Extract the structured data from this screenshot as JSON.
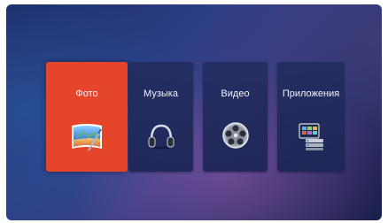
{
  "menu": {
    "tiles": [
      {
        "label": "Фото",
        "icon": "photo-icon",
        "selected": true
      },
      {
        "label": "Музыка",
        "icon": "headphones-icon",
        "selected": false
      },
      {
        "label": "Видео",
        "icon": "film-reel-icon",
        "selected": false
      },
      {
        "label": "Приложения",
        "icon": "apps-icon",
        "selected": false
      }
    ]
  },
  "colors": {
    "selected_tile": "#e5462a",
    "tile": "#232d5f",
    "text": "#f0f2ff"
  }
}
